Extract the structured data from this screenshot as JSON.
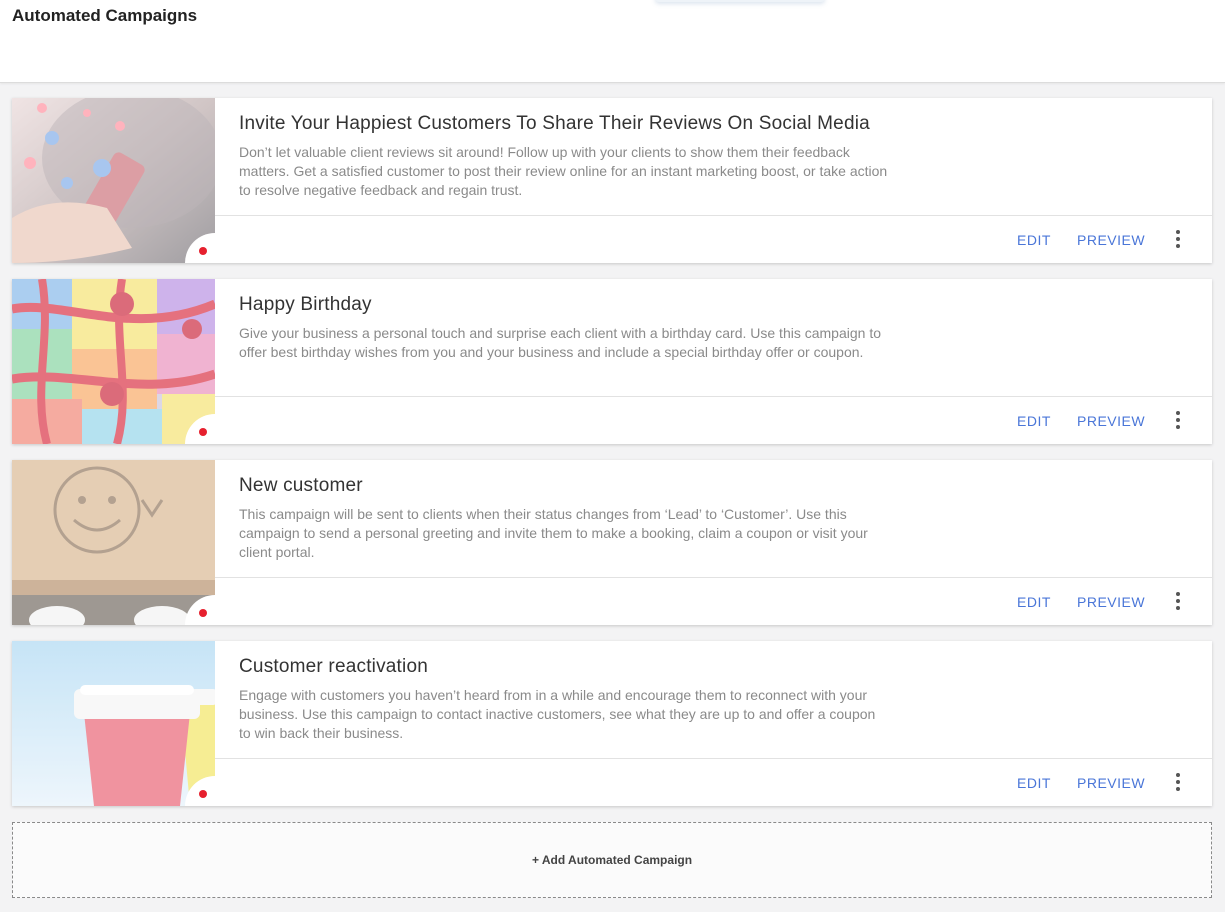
{
  "header": {
    "title": "Automated Campaigns"
  },
  "campaigns": [
    {
      "title": "Invite Your Happiest Customers To Share Their Reviews On Social Media",
      "description": "Don’t let valuable client reviews sit around! Follow up with your clients to show them their feedback matters. Get a satisfied customer to post their review online for an instant marketing boost, or take action to resolve negative feedback and regain trust.",
      "toggle_icon": "×",
      "enabled": false,
      "edit_label": "EDIT",
      "preview_label": "PREVIEW"
    },
    {
      "title": "Happy Birthday",
      "description": "Give your business a personal touch and surprise each client with a birthday card. Use this campaign to offer best birthday wishes from you and your business and include a special birthday offer or coupon.",
      "toggle_icon": "×",
      "enabled": false,
      "edit_label": "EDIT",
      "preview_label": "PREVIEW"
    },
    {
      "title": "New customer",
      "description": "This campaign will be sent to clients when their status changes from ‘Lead’ to ‘Customer’. Use this campaign to send a personal greeting and invite them to make a booking, claim a coupon or visit your client portal.",
      "toggle_icon": "×",
      "enabled": false,
      "edit_label": "EDIT",
      "preview_label": "PREVIEW"
    },
    {
      "title": "Customer reactivation",
      "description": "Engage with customers you haven’t heard from in a while and encourage them to reconnect with your business. Use this campaign to contact inactive customers, see what they are up to and offer a coupon to win back their business.",
      "toggle_icon": "×",
      "enabled": false,
      "edit_label": "EDIT",
      "preview_label": "PREVIEW"
    }
  ],
  "add_campaign": {
    "label": "+ Add Automated Campaign"
  },
  "colors": {
    "accent": "#4a76d8",
    "status_dot": "#e6202e",
    "toggle_knob": "#4b5569"
  }
}
